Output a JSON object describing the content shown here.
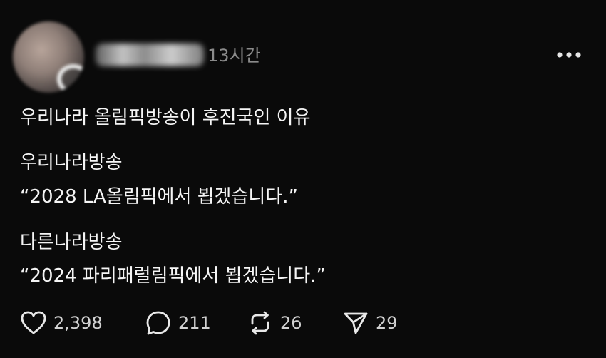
{
  "post": {
    "time": "13시간",
    "lines": [
      "우리나라 올림픽방송이 후진국인 이유",
      "우리나라방송",
      "“2028 LA올림픽에서 뵙겠습니다.”",
      "다른나라방송",
      "“2024 파리패럴림픽에서 뵙겠습니다.”"
    ]
  },
  "actions": {
    "likes": "2,398",
    "comments": "211",
    "reposts": "26",
    "shares": "29"
  },
  "icons": {
    "more": "more-horizontal-icon",
    "like": "heart-icon",
    "comment": "speech-bubble-icon",
    "repost": "repost-icon",
    "share": "send-icon"
  },
  "colors": {
    "background": "#0a0a0a",
    "text": "#f5f5f5",
    "muted": "#8b8b8b"
  }
}
